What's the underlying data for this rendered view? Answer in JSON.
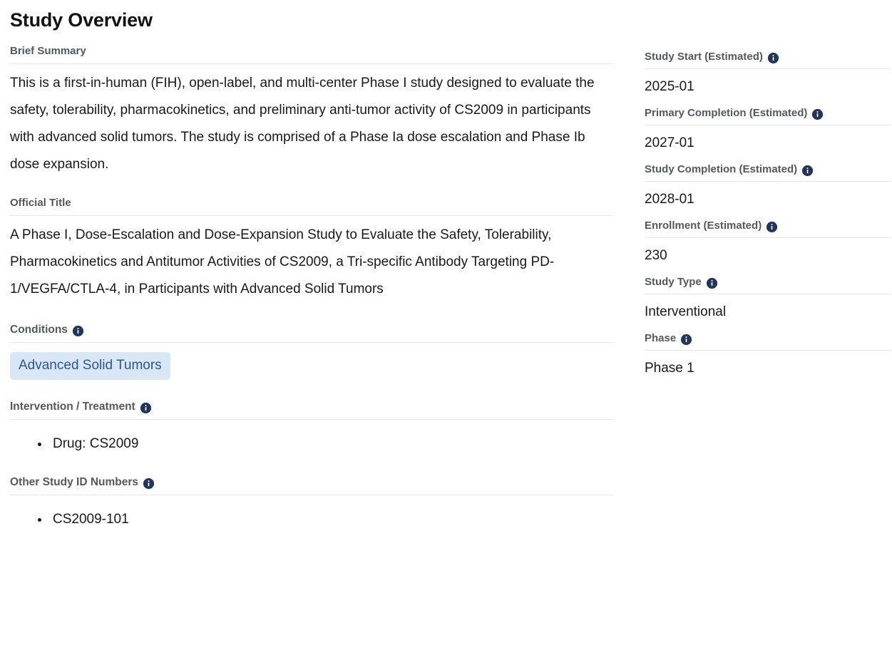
{
  "page": {
    "title": "Study Overview"
  },
  "icons": {
    "info": "info-icon"
  },
  "colors": {
    "badge_background": "#d8e6f6",
    "badge_text": "#2f5596",
    "info_icon": "#21355e",
    "heading_text": "#55595c",
    "divider": "#e3e3e3"
  },
  "left": {
    "brief_summary": {
      "label": "Brief Summary",
      "text": "This is a first-in-human (FIH), open-label, and multi-center Phase I study designed to evaluate the safety, tolerability, pharmacokinetics, and preliminary anti-tumor activity of CS2009 in participants with advanced solid tumors. The study is comprised of a Phase Ia dose escalation and Phase Ib dose expansion."
    },
    "official_title": {
      "label": "Official Title",
      "text": "A Phase I, Dose-Escalation and Dose-Expansion Study to Evaluate the Safety, Tolerability, Pharmacokinetics and Antitumor Activities of CS2009, a Tri-specific Antibody Targeting PD-1/VEGFA/CTLA-4, in Participants with Advanced Solid Tumors"
    },
    "conditions": {
      "label": "Conditions",
      "has_info": true,
      "items": [
        "Advanced Solid Tumors"
      ]
    },
    "intervention": {
      "label": "Intervention / Treatment",
      "has_info": true,
      "items": [
        "Drug: CS2009"
      ]
    },
    "other_ids": {
      "label": "Other Study ID Numbers",
      "has_info": true,
      "items": [
        "CS2009-101"
      ]
    }
  },
  "right": {
    "fields": [
      {
        "label": "Study Start (Estimated)",
        "value": "2025-01"
      },
      {
        "label": "Primary Completion (Estimated)",
        "value": "2027-01"
      },
      {
        "label": "Study Completion (Estimated)",
        "value": "2028-01"
      },
      {
        "label": "Enrollment (Estimated)",
        "value": "230"
      },
      {
        "label": "Study Type",
        "value": "Interventional"
      },
      {
        "label": "Phase",
        "value": "Phase 1"
      }
    ]
  }
}
